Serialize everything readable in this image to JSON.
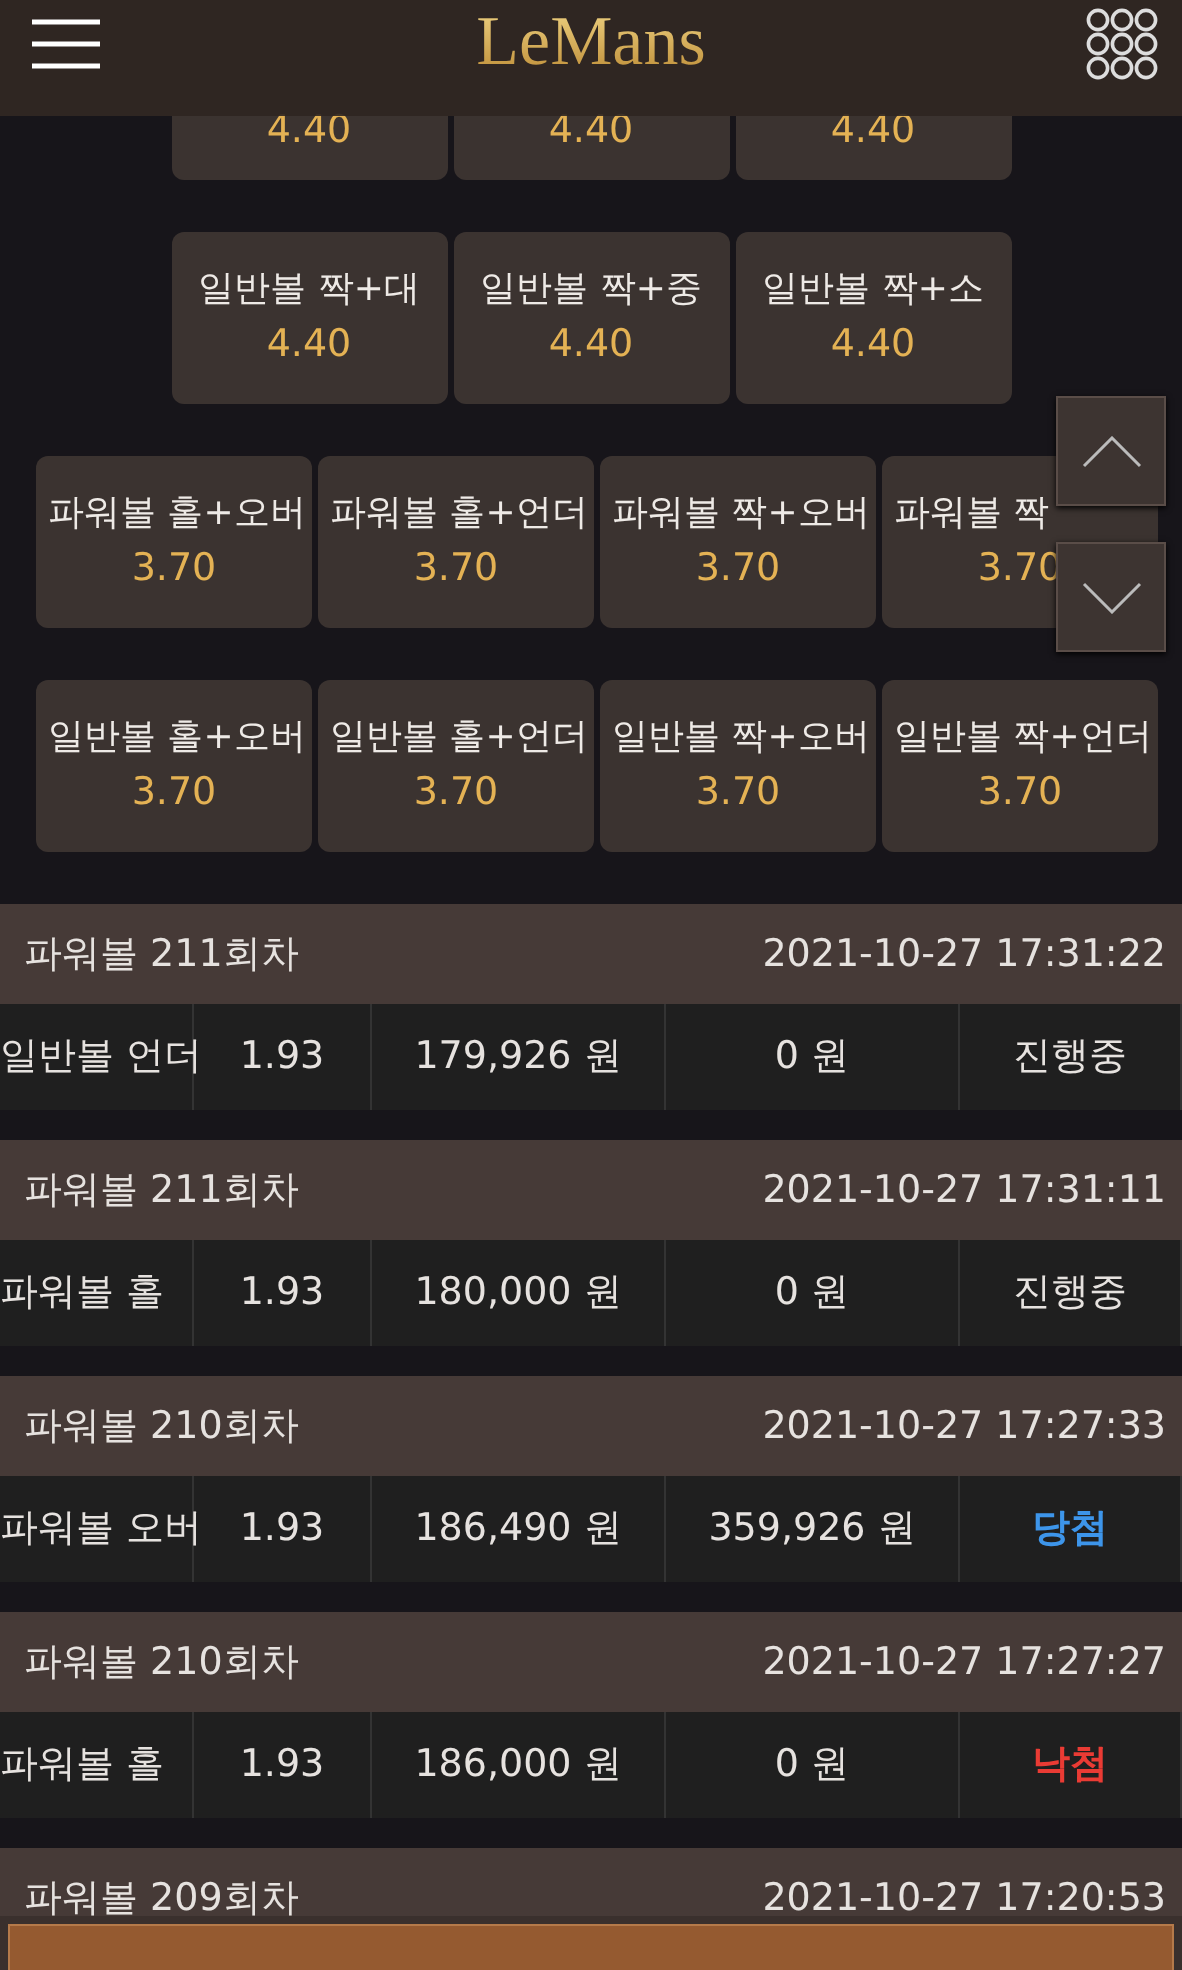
{
  "header": {
    "logo": "LeMans"
  },
  "bet_options": [
    [
      {
        "odds": "4.40"
      },
      {
        "odds": "4.40"
      },
      {
        "odds": "4.40"
      }
    ],
    [
      {
        "label": "일반볼 짝+대",
        "odds": "4.40"
      },
      {
        "label": "일반볼 짝+중",
        "odds": "4.40"
      },
      {
        "label": "일반볼 짝+소",
        "odds": "4.40"
      }
    ],
    [
      {
        "label": "파워볼 홀+오버",
        "odds": "3.70"
      },
      {
        "label": "파워볼 홀+언더",
        "odds": "3.70"
      },
      {
        "label": "파워볼 짝+오버",
        "odds": "3.70"
      },
      {
        "label": "파워볼 짝",
        "odds": "3.70"
      }
    ],
    [
      {
        "label": "일반볼 홀+오버",
        "odds": "3.70"
      },
      {
        "label": "일반볼 홀+언더",
        "odds": "3.70"
      },
      {
        "label": "일반볼 짝+오버",
        "odds": "3.70"
      },
      {
        "label": "일반볼 짝+언더",
        "odds": "3.70"
      }
    ]
  ],
  "history": [
    {
      "title": "파워볼 211회차",
      "time": "2021-10-27 17:31:22",
      "pick": "일반볼 언더",
      "odds": "1.93",
      "amount": "179,926 원",
      "payout": "0 원",
      "result": "진행중",
      "kind": "pending"
    },
    {
      "title": "파워볼 211회차",
      "time": "2021-10-27 17:31:11",
      "pick": "파워볼 홀",
      "odds": "1.93",
      "amount": "180,000 원",
      "payout": "0 원",
      "result": "진행중",
      "kind": "pending"
    },
    {
      "title": "파워볼 210회차",
      "time": "2021-10-27 17:27:33",
      "pick": "파워볼 오버",
      "odds": "1.93",
      "amount": "186,490 원",
      "payout": "359,926 원",
      "result": "당첨",
      "kind": "win"
    },
    {
      "title": "파워볼 210회차",
      "time": "2021-10-27 17:27:27",
      "pick": "파워볼 홀",
      "odds": "1.93",
      "amount": "186,000 원",
      "payout": "0 원",
      "result": "낙첨",
      "kind": "lose"
    },
    {
      "title": "파워볼 209회차",
      "time": "2021-10-27 17:20:53"
    }
  ]
}
